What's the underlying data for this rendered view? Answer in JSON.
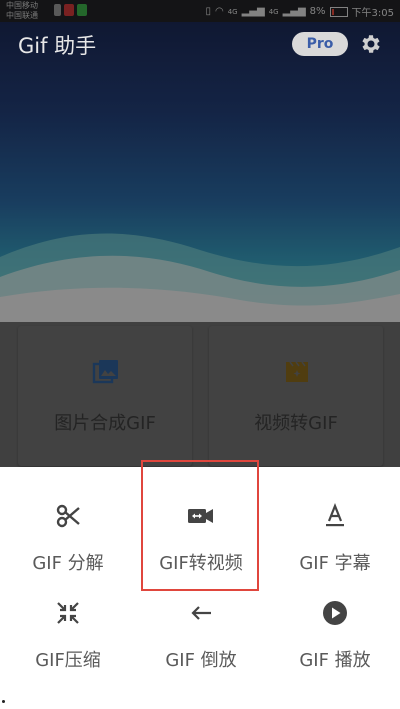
{
  "status_bar": {
    "carrier_1": "中国移动",
    "carrier_2": "中国联通",
    "battery": "8%",
    "time": "下午3:05",
    "network_1": "4G",
    "network_2": "4G"
  },
  "app": {
    "title": "Gif 助手",
    "pro_label": "Pro"
  },
  "cards": [
    {
      "label": "图片合成GIF",
      "icon": "image-icon",
      "color": "#3b7fcf"
    },
    {
      "label": "视频转GIF",
      "icon": "movie-icon",
      "color": "#e0a324"
    }
  ],
  "sheet": {
    "items": [
      {
        "label": "GIF 分解",
        "icon": "scissors-icon"
      },
      {
        "label": "GIF转视频",
        "icon": "video-camera-icon"
      },
      {
        "label": "GIF 字幕",
        "icon": "text-format-icon"
      },
      {
        "label": "GIF压缩",
        "icon": "compress-icon"
      },
      {
        "label": "GIF 倒放",
        "icon": "arrow-left-icon"
      },
      {
        "label": "GIF 播放",
        "icon": "play-circle-icon"
      }
    ]
  },
  "colors": {
    "highlight": "#e0463d",
    "pro_text": "#3a5da8"
  }
}
